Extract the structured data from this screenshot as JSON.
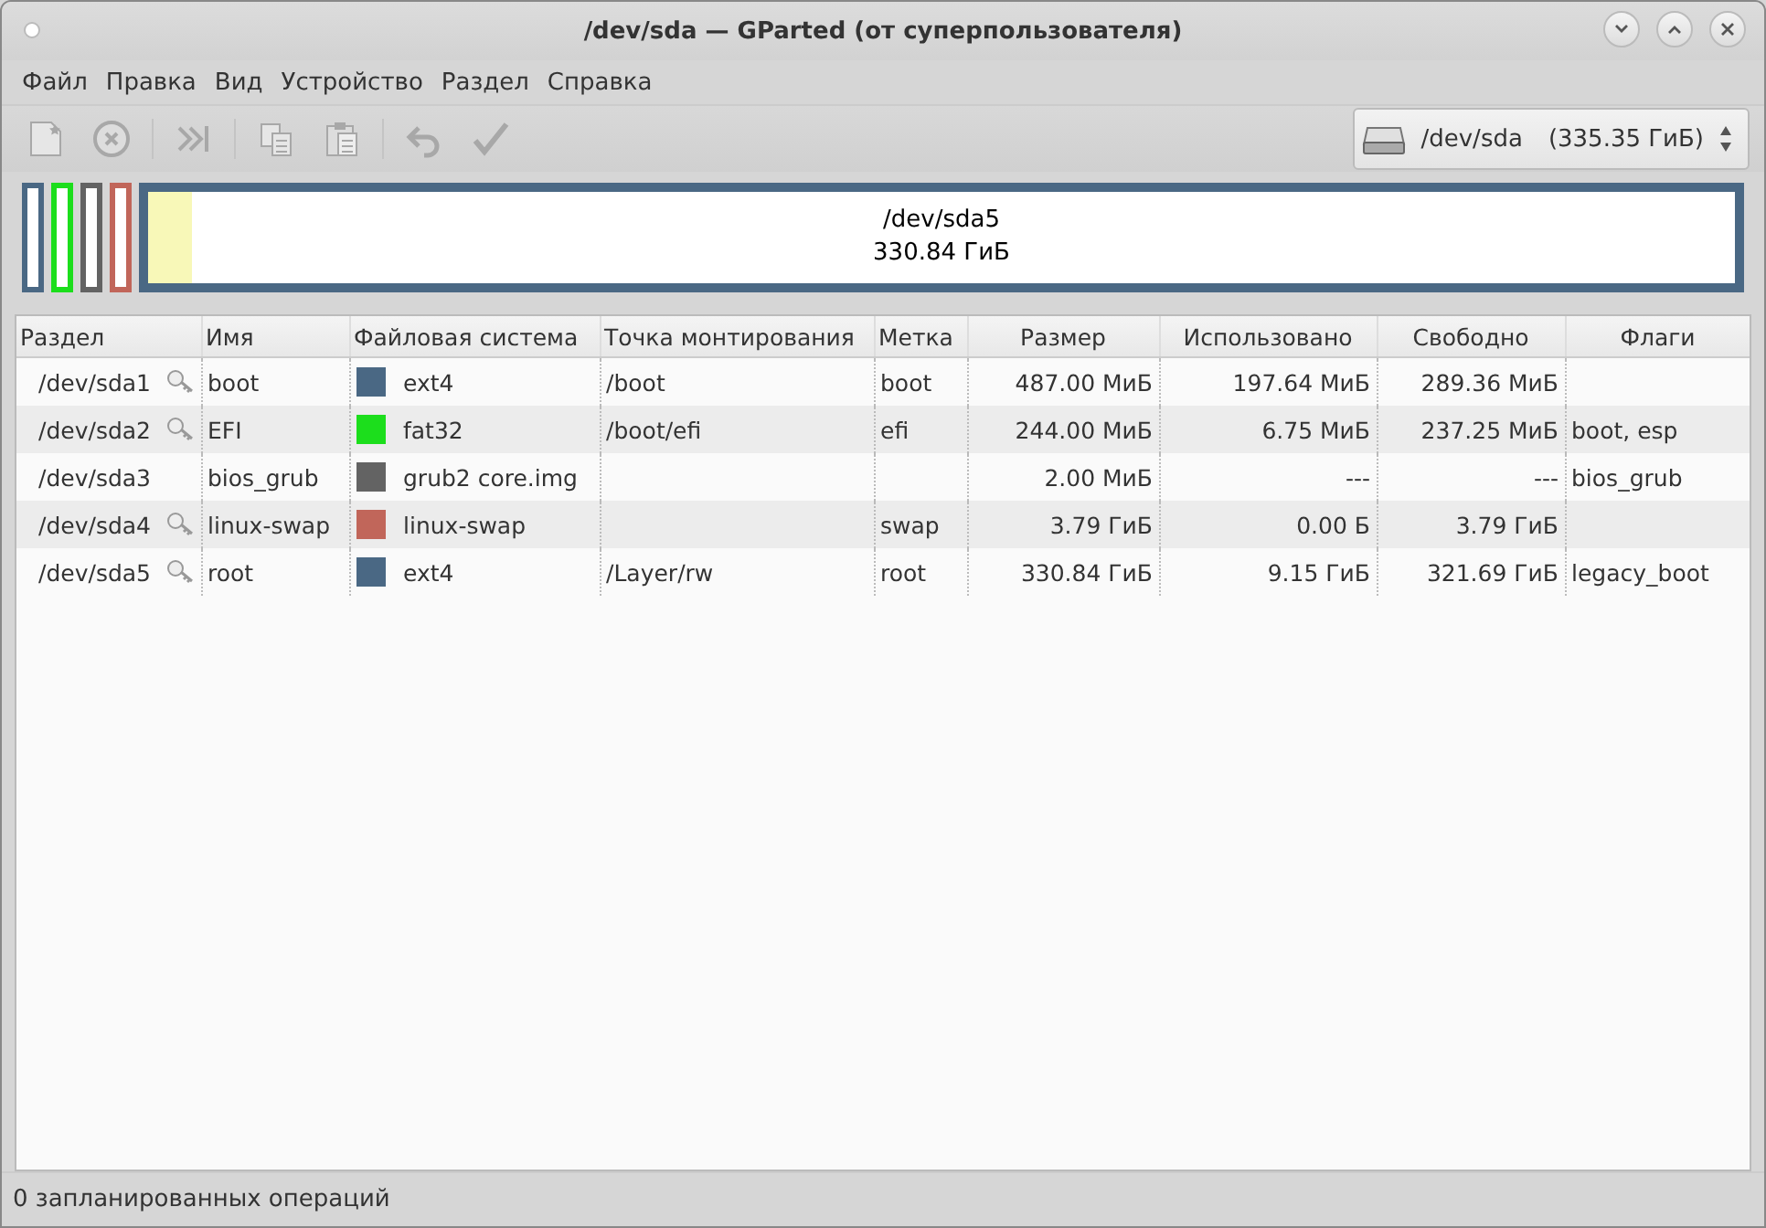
{
  "window": {
    "title": "/dev/sda — GParted (от суперпользователя)"
  },
  "menu": [
    "Файл",
    "Правка",
    "Вид",
    "Устройство",
    "Раздел",
    "Справка"
  ],
  "toolbar": [
    {
      "kind": "new",
      "disabled": true
    },
    {
      "kind": "delete",
      "disabled": true
    },
    {
      "kind": "sep"
    },
    {
      "kind": "resize",
      "disabled": true
    },
    {
      "kind": "sep"
    },
    {
      "kind": "copy",
      "disabled": true
    },
    {
      "kind": "paste",
      "disabled": true
    },
    {
      "kind": "sep"
    },
    {
      "kind": "undo",
      "disabled": true
    },
    {
      "kind": "apply",
      "disabled": true
    }
  ],
  "device": {
    "name": "/dev/sda",
    "size": "(335.35 ГиБ)"
  },
  "disk_map": [
    {
      "color": "#4a6884"
    },
    {
      "color": "#1cde1c"
    },
    {
      "color": "#636363"
    },
    {
      "color": "#c1665a"
    },
    {
      "color": "#4a6884",
      "name": "/dev/sda5",
      "size": "330.84 ГиБ",
      "level": 0.028
    }
  ],
  "table": {
    "columns": [
      "Раздел",
      "Имя",
      "Файловая система",
      "Точка монтирования",
      "Метка",
      "Размер",
      "Использовано",
      "Свободно",
      "Флаги"
    ],
    "rows": [
      {
        "partition": "/dev/sda1",
        "mounted": true,
        "name": "boot",
        "fs": "ext4",
        "color": "#4a6884",
        "mount": "/boot",
        "label": "boot",
        "size": "487.00 МиБ",
        "used": "197.64 МиБ",
        "free": "289.36 МиБ",
        "flags": ""
      },
      {
        "partition": "/dev/sda2",
        "mounted": true,
        "name": "EFI",
        "fs": "fat32",
        "color": "#1cde1c",
        "mount": "/boot/efi",
        "label": "efi",
        "size": "244.00 МиБ",
        "used": "6.75 МиБ",
        "free": "237.25 МиБ",
        "flags": "boot, esp"
      },
      {
        "partition": "/dev/sda3",
        "mounted": false,
        "name": "bios_grub",
        "fs": "grub2 core.img",
        "color": "#636363",
        "mount": "",
        "label": "",
        "size": "2.00 МиБ",
        "used": "---",
        "free": "---",
        "flags": "bios_grub"
      },
      {
        "partition": "/dev/sda4",
        "mounted": true,
        "name": "linux-swap",
        "fs": "linux-swap",
        "color": "#c1665a",
        "mount": "",
        "label": "swap",
        "size": "3.79 ГиБ",
        "used": "0.00 Б",
        "free": "3.79 ГиБ",
        "flags": ""
      },
      {
        "partition": "/dev/sda5",
        "mounted": true,
        "name": "root",
        "fs": "ext4",
        "color": "#4a6884",
        "mount": "/Layer/rw",
        "label": "root",
        "size": "330.84 ГиБ",
        "used": "9.15 ГиБ",
        "free": "321.69 ГиБ",
        "flags": "legacy_boot"
      }
    ]
  },
  "status_bar": "0 запланированных операций"
}
